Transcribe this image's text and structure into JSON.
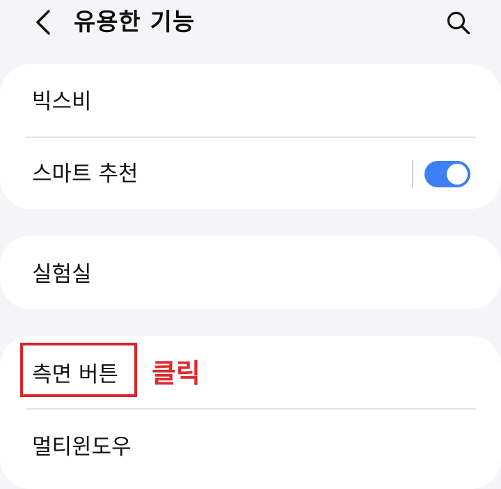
{
  "header": {
    "title": "유용한 기능",
    "back_icon": "chevron-left-icon",
    "search_icon": "search-icon"
  },
  "groups": [
    {
      "items": [
        {
          "label": "빅스비"
        },
        {
          "label": "스마트 추천",
          "toggle": true
        }
      ]
    },
    {
      "items": [
        {
          "label": "실험실"
        }
      ]
    },
    {
      "items": [
        {
          "label": "측면 버튼"
        },
        {
          "label": "멀티윈도우"
        }
      ]
    }
  ],
  "annotation": {
    "text": "클릭",
    "color": "#e0282d"
  },
  "colors": {
    "background": "#f5f5f7",
    "card": "#ffffff",
    "toggle_on": "#3d7ff5",
    "highlight": "#d7262c"
  }
}
